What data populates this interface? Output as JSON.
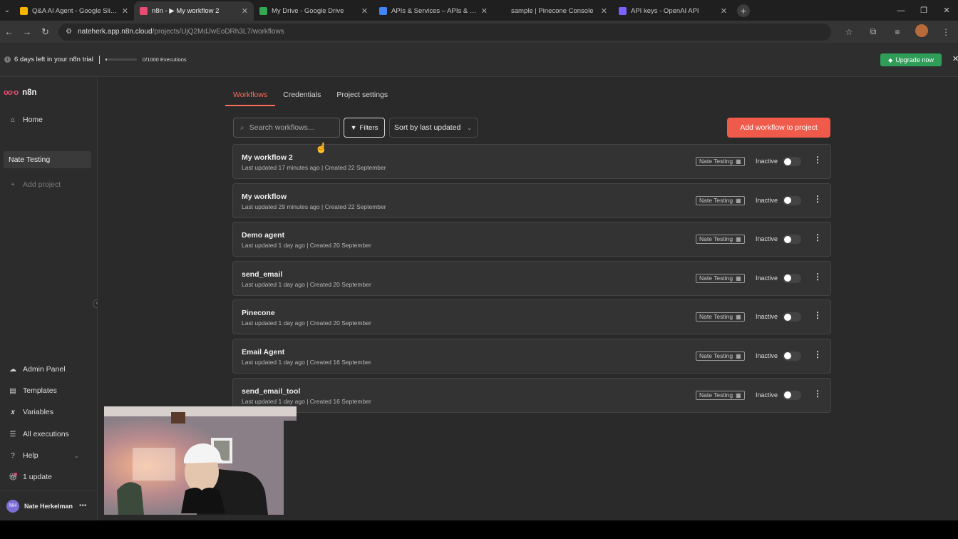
{
  "browser": {
    "tabs": [
      {
        "label": "Q&A AI Agent - Google Slides",
        "favicon_color": "#f4b400",
        "active": false
      },
      {
        "label": "n8n - ▶ My workflow 2",
        "favicon_color": "#ea4b71",
        "active": true
      },
      {
        "label": "My Drive - Google Drive",
        "favicon_color": "#34a853",
        "active": false
      },
      {
        "label": "APIs & Services – APIs & Servic",
        "favicon_color": "#4285f4",
        "active": false
      },
      {
        "label": "sample | Pinecone Console",
        "favicon_color": "#1f1f1f",
        "active": false
      },
      {
        "label": "API keys - OpenAI API",
        "favicon_color": "#7b61ff",
        "active": false
      }
    ],
    "url_host": "nateherk.app.n8n.cloud",
    "url_path": "/projects/UjQ2MdJwEoDRh3L7/workflows"
  },
  "banner": {
    "trial_text": "6 days left in your n8n trial",
    "executions_text": "0/1000 Executions",
    "executions_used_fraction": 0.05,
    "upgrade_label": "Upgrade now",
    "upgrade_color": "#2e9e58"
  },
  "sidebar": {
    "logo_text": "n8n",
    "home_label": "Home",
    "current_project": "Nate Testing",
    "add_project_label": "Add project",
    "bottom_items": [
      {
        "label": "Admin Panel",
        "icon": "cloud-icon"
      },
      {
        "label": "Templates",
        "icon": "box-icon"
      },
      {
        "label": "Variables",
        "icon": "variable-icon"
      },
      {
        "label": "All executions",
        "icon": "list-icon"
      },
      {
        "label": "Help",
        "icon": "question-icon"
      },
      {
        "label": "1 update",
        "icon": "gift-icon"
      }
    ],
    "user_initials": "NH",
    "user_name": "Nate Herkelman"
  },
  "main": {
    "tabs": [
      "Workflows",
      "Credentials",
      "Project settings"
    ],
    "active_tab": "Workflows",
    "accent_color": "#ff6d5a",
    "search_placeholder": "Search workflows...",
    "filters_label": "Filters",
    "sort_label": "Sort by last updated",
    "add_workflow_label": "Add workflow to project",
    "add_workflow_color": "#ef5a4b",
    "workflows": [
      {
        "name": "My workflow 2",
        "meta": "Last updated 17 minutes ago | Created 22 September",
        "project": "Nate Testing",
        "status": "Inactive"
      },
      {
        "name": "My workflow",
        "meta": "Last updated 29 minutes ago | Created 22 September",
        "project": "Nate Testing",
        "status": "Inactive"
      },
      {
        "name": "Demo agent",
        "meta": "Last updated 1 day ago | Created 20 September",
        "project": "Nate Testing",
        "status": "Inactive"
      },
      {
        "name": "send_email",
        "meta": "Last updated 1 day ago | Created 20 September",
        "project": "Nate Testing",
        "status": "Inactive"
      },
      {
        "name": "Pinecone",
        "meta": "Last updated 1 day ago | Created 20 September",
        "project": "Nate Testing",
        "status": "Inactive"
      },
      {
        "name": "Email Agent",
        "meta": "Last updated 1 day ago | Created 16 September",
        "project": "Nate Testing",
        "status": "Inactive"
      },
      {
        "name": "send_email_tool",
        "meta": "Last updated 1 day ago | Created 16 September",
        "project": "Nate Testing",
        "status": "Inactive"
      }
    ]
  }
}
